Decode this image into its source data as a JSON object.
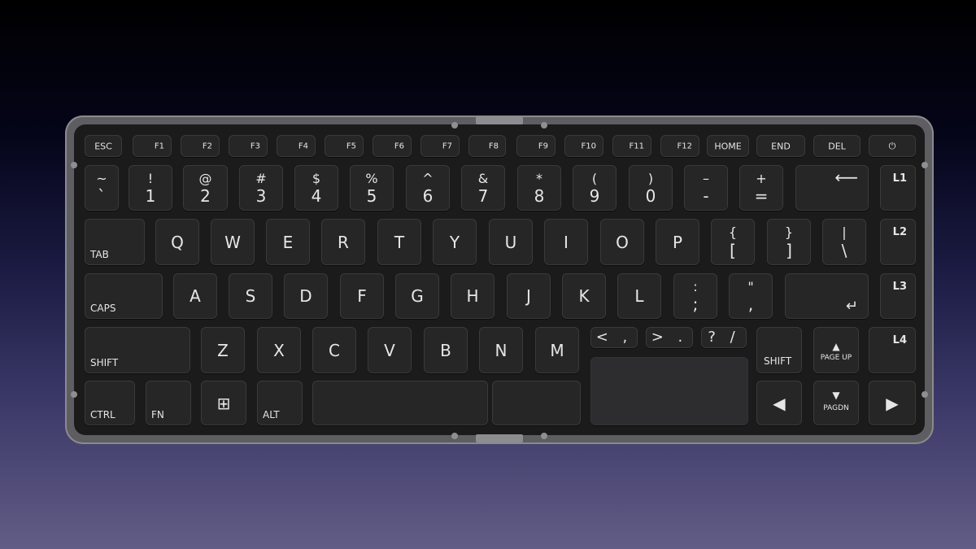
{
  "keyboard": {
    "rows": [
      [
        {
          "t": "ESC"
        },
        {
          "t": "F1"
        },
        {
          "t": "F2"
        },
        {
          "t": "F3"
        },
        {
          "t": "F4"
        },
        {
          "t": "F5"
        },
        {
          "t": "F6"
        },
        {
          "t": "F7"
        },
        {
          "t": "F8"
        },
        {
          "t": "F9"
        },
        {
          "t": "F10"
        },
        {
          "t": "F11"
        },
        {
          "t": "F12"
        },
        {
          "t": "HOME"
        },
        {
          "t": "END"
        },
        {
          "t": "DEL"
        },
        {
          "t": "⏻",
          "name": "power"
        }
      ],
      [
        {
          "t": "~",
          "b": "`"
        },
        {
          "t": "!",
          "b": "1"
        },
        {
          "t": "@",
          "b": "2"
        },
        {
          "t": "#",
          "b": "3"
        },
        {
          "t": "$",
          "b": "4"
        },
        {
          "t": "%",
          "b": "5"
        },
        {
          "t": "^",
          "b": "6"
        },
        {
          "t": "&",
          "b": "7"
        },
        {
          "t": "*",
          "b": "8"
        },
        {
          "t": "(",
          "b": "9"
        },
        {
          "t": ")",
          "b": "0"
        },
        {
          "t": "–",
          "b": "-"
        },
        {
          "t": "+",
          "b": "="
        },
        {
          "t": "⟵",
          "name": "backspace"
        },
        {
          "t": "L1"
        }
      ],
      [
        {
          "t": "TAB"
        },
        {
          "t": "Q"
        },
        {
          "t": "W"
        },
        {
          "t": "E"
        },
        {
          "t": "R"
        },
        {
          "t": "T"
        },
        {
          "t": "Y"
        },
        {
          "t": "U"
        },
        {
          "t": "I"
        },
        {
          "t": "O"
        },
        {
          "t": "P"
        },
        {
          "t": "{",
          "b": "["
        },
        {
          "t": "}",
          "b": "]"
        },
        {
          "t": "|",
          "b": "\\"
        },
        {
          "t": "L2"
        }
      ],
      [
        {
          "t": "CAPS"
        },
        {
          "t": "A"
        },
        {
          "t": "S"
        },
        {
          "t": "D"
        },
        {
          "t": "F"
        },
        {
          "t": "G"
        },
        {
          "t": "H"
        },
        {
          "t": "J"
        },
        {
          "t": "K"
        },
        {
          "t": "L"
        },
        {
          "t": ":",
          "b": ";"
        },
        {
          "t": "\"",
          "b": ","
        },
        {
          "t": "↵",
          "name": "enter"
        },
        {
          "t": "L3"
        }
      ],
      [
        {
          "t": "SHIFT"
        },
        {
          "t": "Z"
        },
        {
          "t": "X"
        },
        {
          "t": "C"
        },
        {
          "t": "V"
        },
        {
          "t": "B"
        },
        {
          "t": "N"
        },
        {
          "t": "M"
        },
        {
          "t": "< ,"
        },
        {
          "t": "> ."
        },
        {
          "t": "? /"
        },
        {
          "t": "SHIFT"
        },
        {
          "t": "▲",
          "b": "PAGE UP"
        },
        {
          "t": "L4"
        }
      ],
      [
        {
          "t": "CTRL"
        },
        {
          "t": "FN"
        },
        {
          "t": "⊞",
          "name": "windows"
        },
        {
          "t": "ALT"
        },
        {
          "t": "",
          "name": "space"
        },
        {
          "t": "",
          "name": "space-right"
        },
        {
          "t": "",
          "name": "trackpad"
        },
        {
          "t": "◀",
          "name": "arrow-left"
        },
        {
          "t": "▼",
          "b": "PAGDN"
        },
        {
          "t": "▶",
          "name": "arrow-right"
        }
      ]
    ]
  }
}
